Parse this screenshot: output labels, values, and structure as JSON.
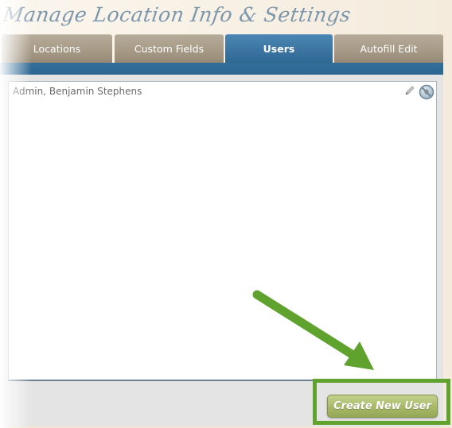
{
  "header": {
    "title": "Manage Location Info & Settings"
  },
  "tabs": [
    {
      "label": "Locations",
      "active": false
    },
    {
      "label": "Custom Fields",
      "active": false
    },
    {
      "label": "Users",
      "active": true
    },
    {
      "label": "Autofill Edit",
      "active": false
    }
  ],
  "users": [
    {
      "name": "Admin, Benjamin Stephens",
      "icons": [
        "pencil-icon",
        "delete-icon"
      ]
    }
  ],
  "actions": {
    "create_user_label": "Create New User"
  },
  "annotation": {
    "color": "#5fa22e",
    "arrow": "pointing-to-create-new-user",
    "highlight": "create-new-user-button"
  },
  "colors": {
    "active_tab": "#3a73a0",
    "inactive_tab": "#a79b87",
    "button": "#a9bb6a"
  }
}
